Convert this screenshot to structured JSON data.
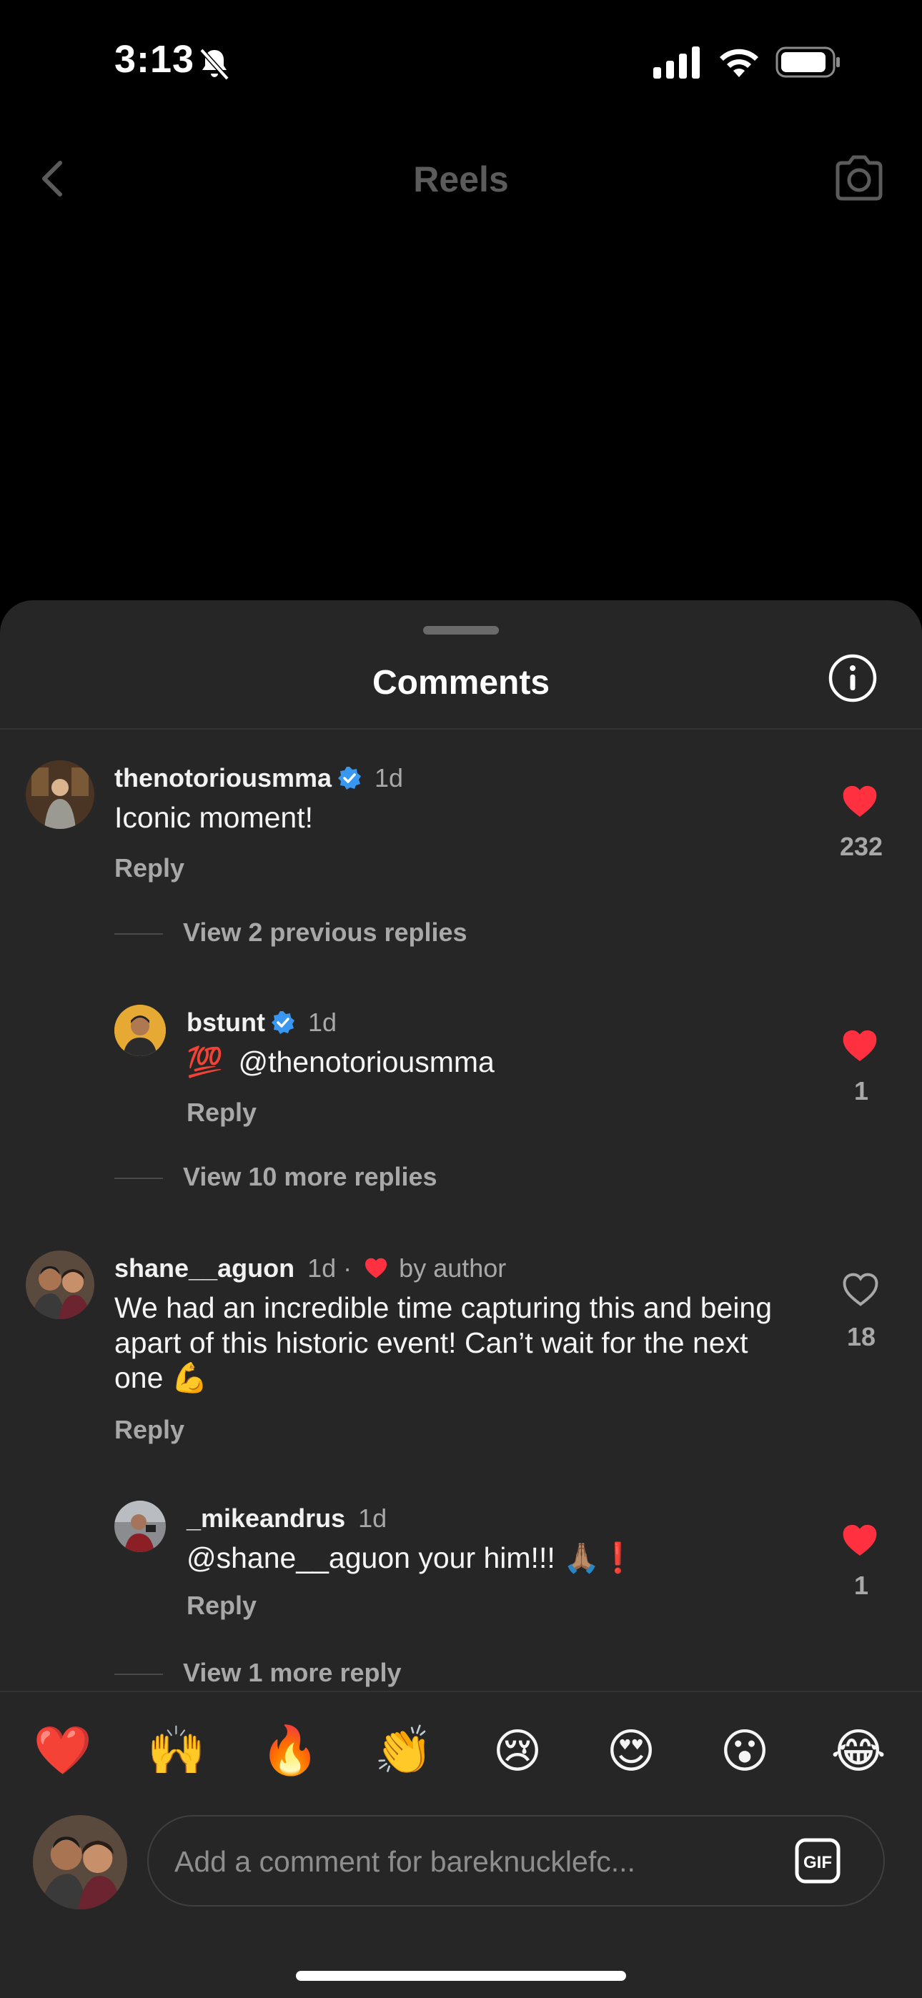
{
  "status_bar": {
    "time": "3:13"
  },
  "header": {
    "title": "Reels"
  },
  "sheet": {
    "title": "Comments"
  },
  "comments": [
    {
      "username": "thenotoriousmma",
      "verified": true,
      "time": "1d",
      "text": "Iconic moment!",
      "reply_label": "Reply",
      "likes": "232",
      "liked": true
    },
    {
      "username": "bstunt",
      "verified": true,
      "time": "1d",
      "emoji": "💯",
      "text": "@thenotoriousmma",
      "reply_label": "Reply",
      "likes": "1",
      "liked": true
    },
    {
      "username": "shane__aguon",
      "verified": false,
      "time": "1d ·",
      "author_badge": "by author",
      "text": "We had an incredible time capturing this and being apart of this historic event! Can’t wait for the next one",
      "emoji": "💪",
      "reply_label": "Reply",
      "likes": "18",
      "liked": false
    },
    {
      "username": "_mikeandrus",
      "verified": false,
      "time": "1d",
      "text": "@shane__aguon your him!!!",
      "emoji": "🙏🏽❗",
      "reply_label": "Reply",
      "likes": "1",
      "liked": true
    }
  ],
  "view_replies": {
    "first": "View 2 previous replies",
    "second": "View 10 more replies",
    "third": "View 1 more reply"
  },
  "quick_reactions": [
    "❤️",
    "🙌",
    "🔥",
    "👏",
    "😢",
    "😍",
    "😮",
    "😂"
  ],
  "composer": {
    "placeholder": "Add a comment for bareknucklefc...",
    "gif_label": "GIF"
  },
  "colors": {
    "like_red": "#ff3040",
    "verified_blue": "#3897f0",
    "sheet_bg": "#262626"
  }
}
